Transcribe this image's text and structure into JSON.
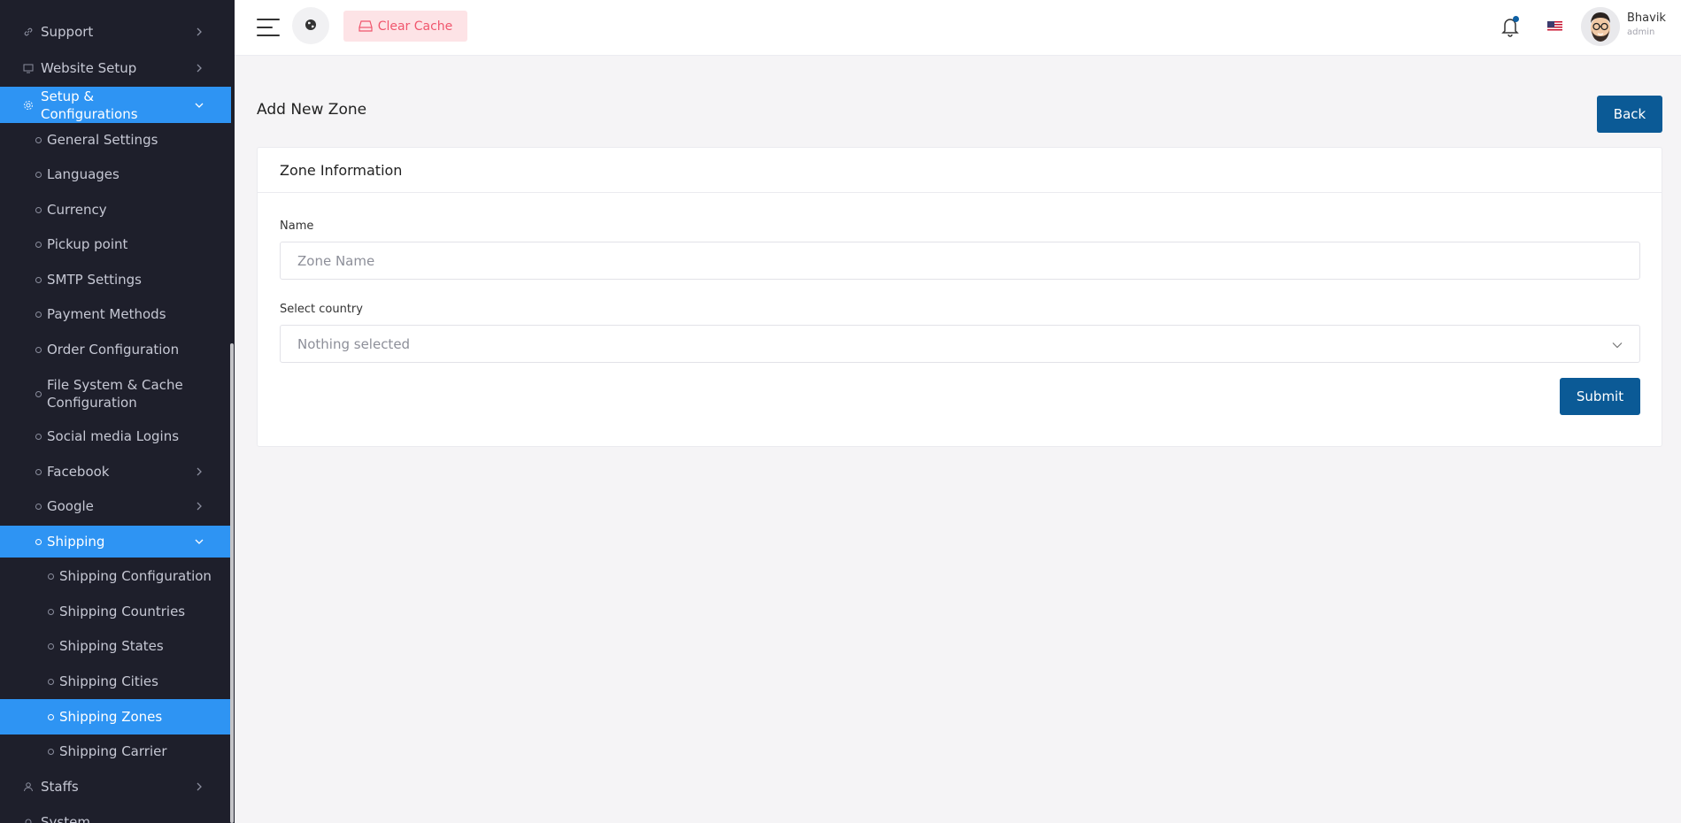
{
  "sidebar": {
    "top_items": [
      {
        "label": "Support",
        "icon": "link-icon"
      },
      {
        "label": "Website Setup",
        "icon": "monitor-icon"
      },
      {
        "label": "Setup & Configurations",
        "icon": "gear-icon"
      }
    ],
    "setup_children": [
      {
        "label": "General Settings"
      },
      {
        "label": "Languages"
      },
      {
        "label": "Currency"
      },
      {
        "label": "Pickup point"
      },
      {
        "label": "SMTP Settings"
      },
      {
        "label": "Payment Methods"
      },
      {
        "label": "Order Configuration"
      },
      {
        "label": "File System & Cache Configuration"
      },
      {
        "label": "Social media Logins"
      },
      {
        "label": "Facebook"
      },
      {
        "label": "Google"
      },
      {
        "label": "Shipping"
      }
    ],
    "shipping_children": [
      {
        "label": "Shipping Configuration"
      },
      {
        "label": "Shipping Countries"
      },
      {
        "label": "Shipping States"
      },
      {
        "label": "Shipping Cities"
      },
      {
        "label": "Shipping Zones"
      },
      {
        "label": "Shipping Carrier"
      }
    ],
    "bottom_items": [
      {
        "label": "Staffs",
        "icon": "user-icon"
      },
      {
        "label": "System",
        "icon": "gear-icon"
      }
    ],
    "active_section": "Setup & Configurations",
    "active_item": "Shipping Zones",
    "active_color": "#2e94f3"
  },
  "topbar": {
    "clear_cache_label": "Clear Cache",
    "user": {
      "name": "Bhavik",
      "role": "admin"
    },
    "accent_color": "#0b5a96"
  },
  "main": {
    "page_title": "Add New Zone",
    "back_label": "Back",
    "card": {
      "title": "Zone Information",
      "name_label": "Name",
      "name_value": "",
      "name_placeholder": "Zone Name",
      "country_label": "Select country",
      "country_value": "Nothing selected",
      "submit_label": "Submit"
    }
  }
}
